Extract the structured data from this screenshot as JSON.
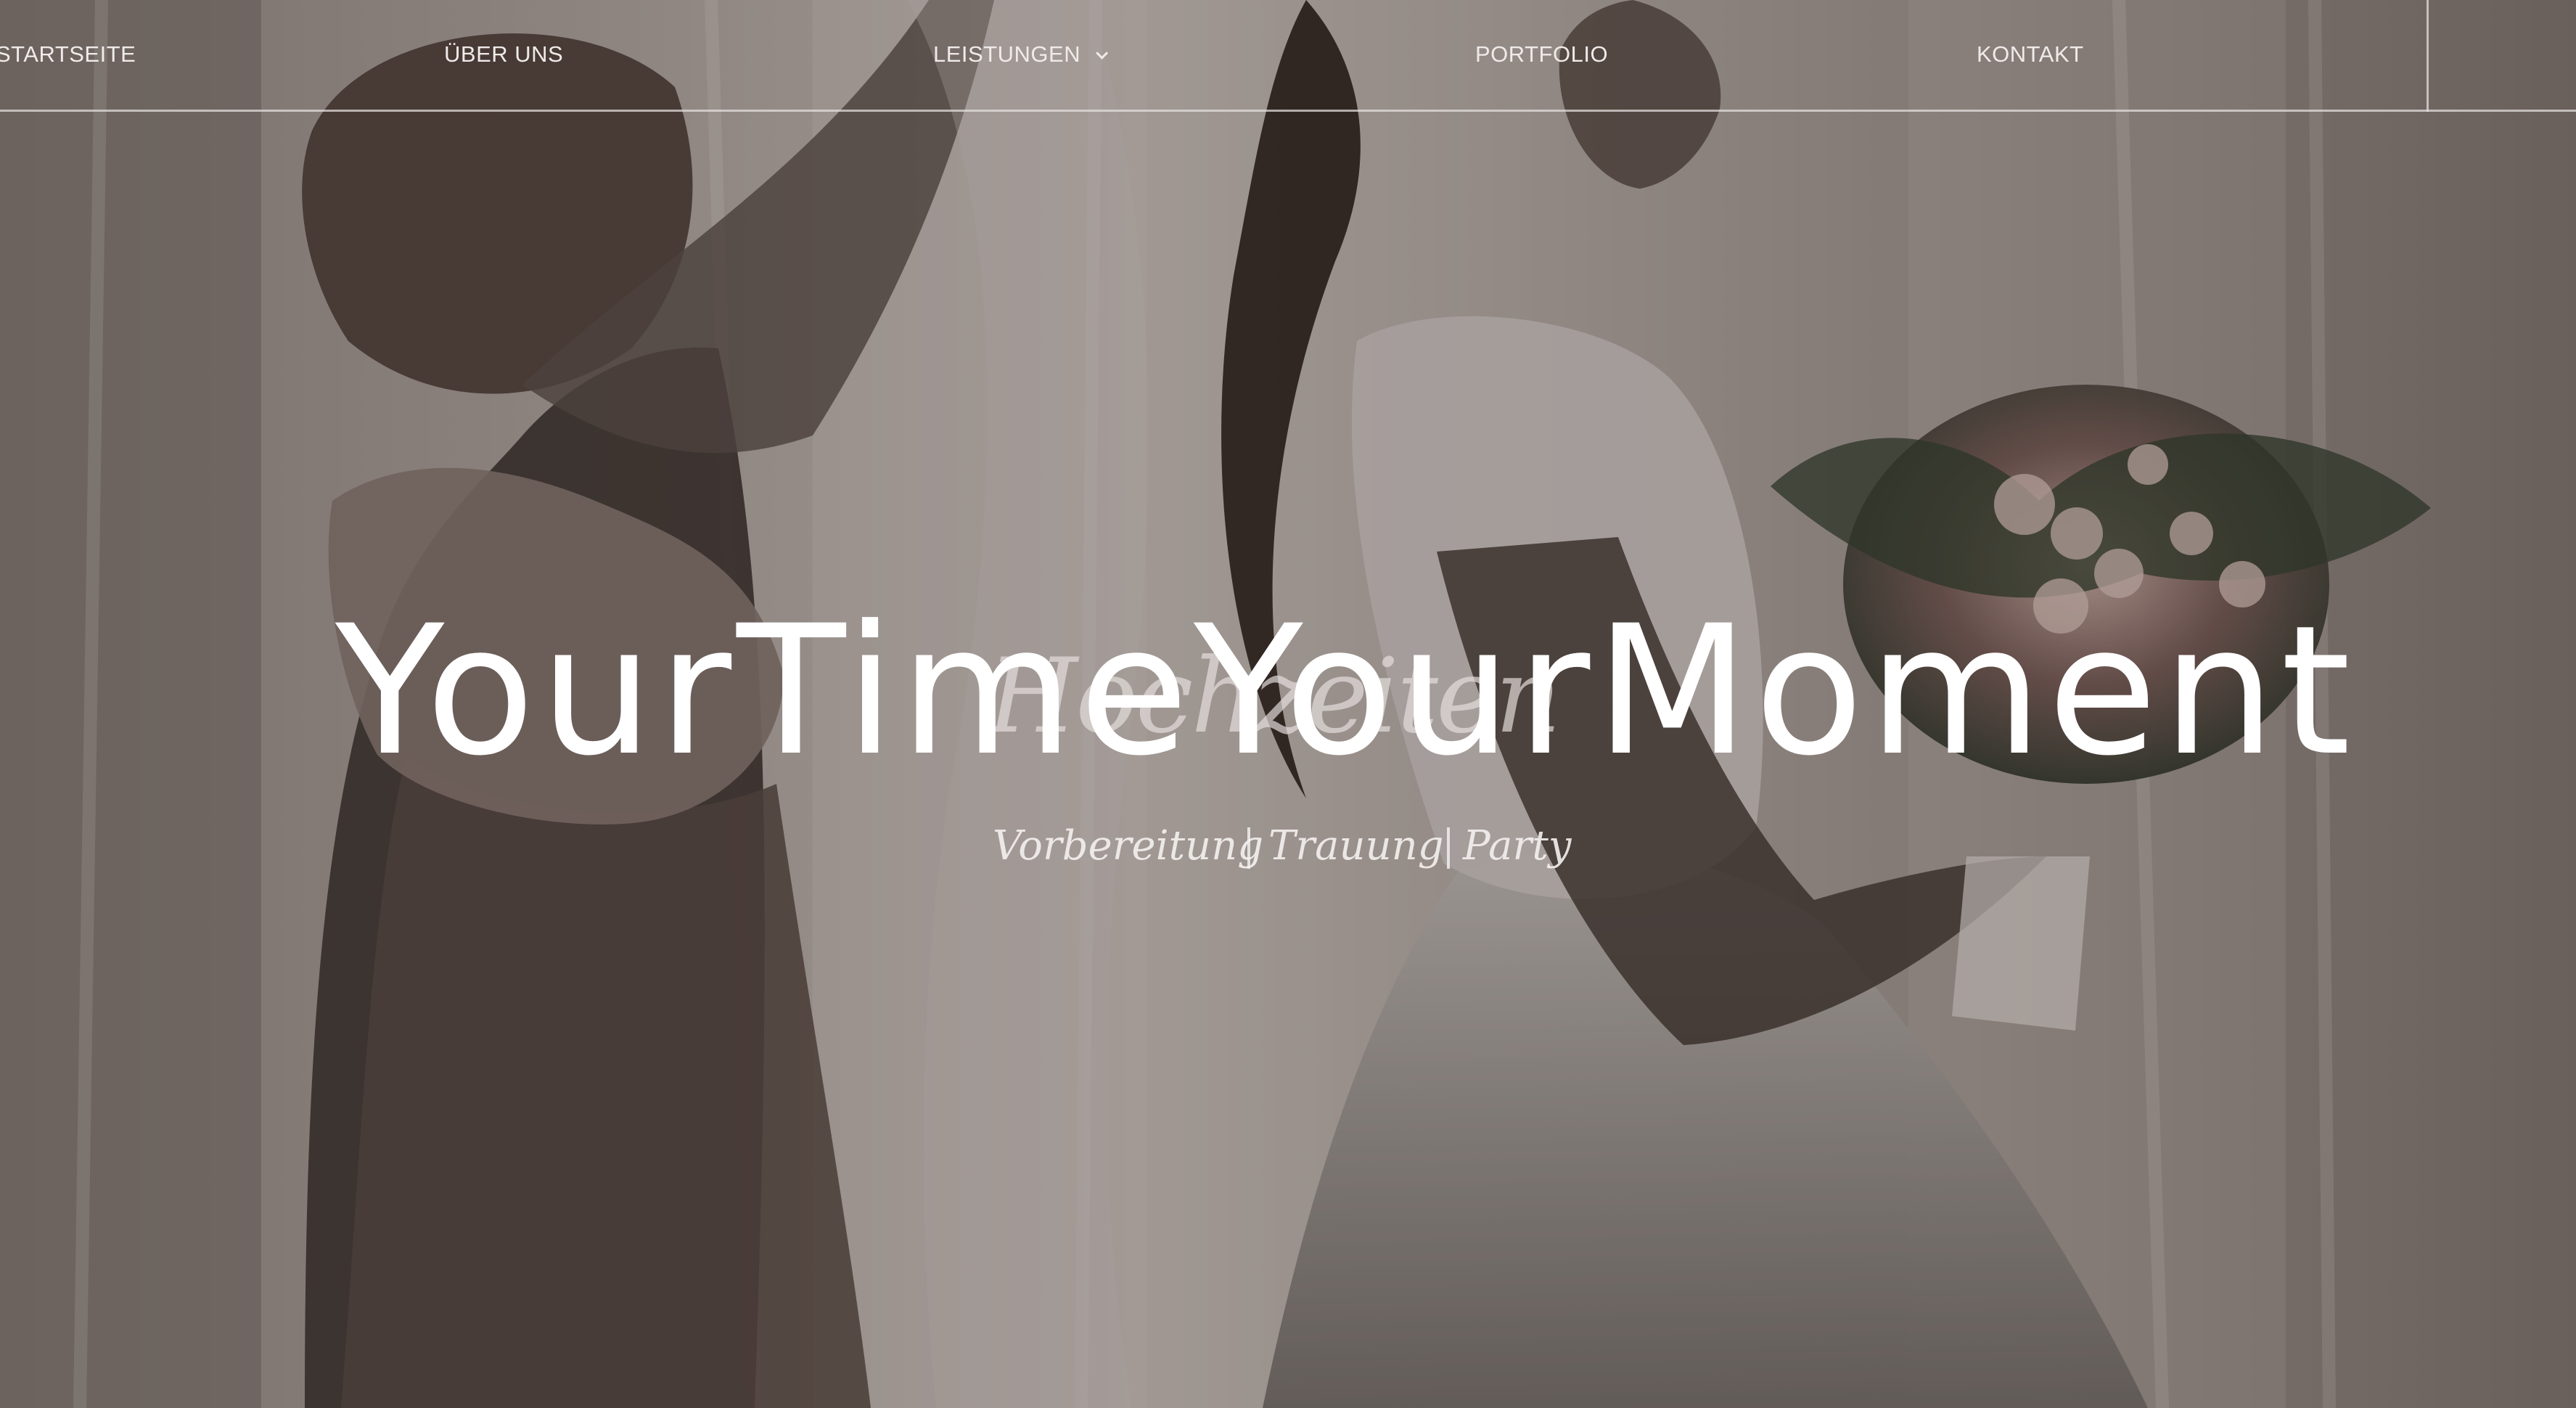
{
  "navigation": {
    "items": [
      {
        "label": "STARTSEITE"
      },
      {
        "label": "ÜBER UNS"
      },
      {
        "label": "LEISTUNGEN"
      },
      {
        "label": "PORTFOLIO"
      },
      {
        "label": "KONTAKT"
      }
    ]
  },
  "hero": {
    "title": "YourTimeYourMoment",
    "script_title": "Hochzeiten",
    "subtitle_parts": [
      "Vorbereitung",
      "Trauung",
      "Party"
    ]
  },
  "icons": {
    "services_dropdown": "chevron-down-icon"
  },
  "colors": {
    "text_primary": "#ffffff",
    "nav_text": "#efebea",
    "nav_line": "#e6e2e0",
    "overlay": "#231c19"
  }
}
